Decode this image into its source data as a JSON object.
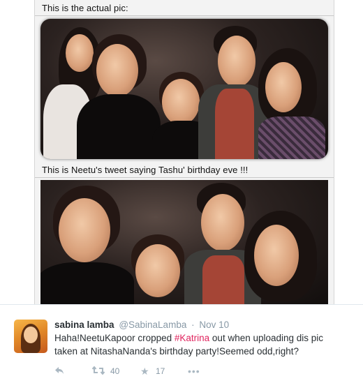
{
  "media": {
    "caption_top": "This is the actual pic:",
    "caption_mid": "This is Neetu's tweet saying Tashu' birthday eve !!!"
  },
  "tweet": {
    "name": "sabina lamba",
    "handle": "@SabinaLamba",
    "separator": "·",
    "time": "Nov 10",
    "text_before": "Haha!NeetuKapoor cropped ",
    "hashtag": "#Katrina",
    "text_after": " out when uploading dis pic taken at NitashaNanda's birthday party!Seemed odd,right?",
    "actions": {
      "reply_icon": "reply-icon",
      "retweet_icon": "retweet-icon",
      "retweet_count": "40",
      "favorite_icon": "star-icon",
      "favorite_count": "17",
      "more_icon": "more-icon"
    }
  },
  "colors": {
    "hashtag": "#e0245e",
    "meta": "#8899a6",
    "text": "#292f33"
  }
}
